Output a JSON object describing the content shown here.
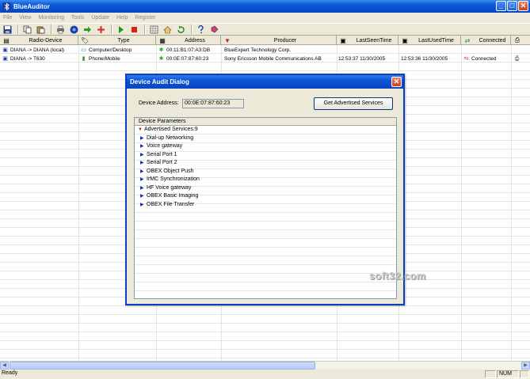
{
  "window": {
    "title": "BlueAuditor",
    "minimize": "_",
    "maximize": "□",
    "close": "✕"
  },
  "menu": [
    "File",
    "View",
    "Monitoring",
    "Tools",
    "Update",
    "Help",
    "Register"
  ],
  "toolbar": {
    "icons": [
      "save-icon",
      "copy-icon",
      "paste-icon",
      "print-icon",
      "bluetooth-icon",
      "arrow-right-icon",
      "add-icon",
      "play-icon",
      "stop-icon",
      "grid-icon",
      "home-icon",
      "refresh-icon",
      "help-icon",
      "register-icon"
    ]
  },
  "grid": {
    "columns": [
      "Radio-Device",
      "Type",
      "Address",
      "Producer",
      "LastSeenTime",
      "LastUsedTime",
      "Connected",
      ""
    ],
    "rows": [
      {
        "device": "DIANA -> DIANA (local)",
        "type": "Computer/Desktop",
        "address": "00:11:B1:07:A3:DB",
        "producer": "BlueExpert Technology Corp.",
        "last_seen": "",
        "last_used": "",
        "connected": ""
      },
      {
        "device": "DIANA -> T630",
        "type": "Phone/Mobile",
        "address": "00:0E:07:87:60:23",
        "producer": "Sony Ericsson Mobile Communications AB",
        "last_seen": "12:53:37 11/30/2005",
        "last_used": "12:53:36 11/30/2005",
        "connected": "Connected"
      }
    ]
  },
  "dialog": {
    "title": "Device Audit Dialog",
    "close": "✕",
    "address_label": "Device Address:",
    "address_value": "00:0E:07:87:60:23",
    "button": "Get Advertised Services",
    "params_header": "Device Parameters",
    "root": "Advertised Services:9",
    "services": [
      "Dial-up Networking",
      "Voice gateway",
      "Serial Port 1",
      "Serial Port 2",
      "OBEX Object Push",
      "IrMC Synchronization",
      "HF Voice gateway",
      "OBEX Basic Imaging",
      "OBEX File Transfer"
    ]
  },
  "status": {
    "text": "Ready",
    "num": "NUM"
  },
  "watermark": "soft32.com"
}
